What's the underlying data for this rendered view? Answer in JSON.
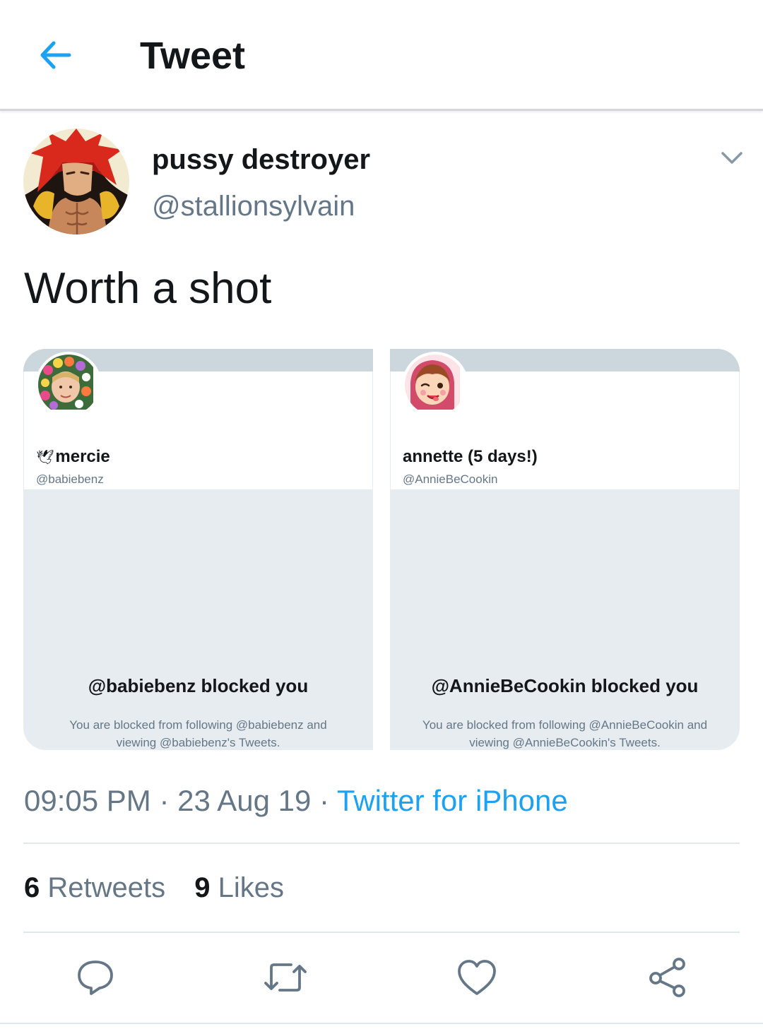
{
  "header": {
    "title": "Tweet",
    "back_icon": "arrow-left-icon"
  },
  "author": {
    "name": "pussy destroyer",
    "handle": "@stallionsylvain",
    "menu_icon": "chevron-down-icon"
  },
  "tweet": {
    "text": "Worth a shot"
  },
  "media": [
    {
      "emoji_prefix": "🕊",
      "name": "mercie",
      "handle": "@babiebenz",
      "blocked_title": "@babiebenz blocked you",
      "blocked_text": "You are blocked from following @babiebenz and viewing @babiebenz's Tweets."
    },
    {
      "name": "annette (5 days!)",
      "handle": "@AnnieBeCookin",
      "blocked_title": "@AnnieBeCookin blocked you",
      "blocked_text": "You are blocked from following @AnnieBeCookin and viewing @AnnieBeCookin's Tweets."
    }
  ],
  "meta": {
    "time": "09:05 PM",
    "separator": "·",
    "date": "23 Aug 19",
    "source": "Twitter for iPhone"
  },
  "stats": {
    "retweets_count": "6",
    "retweets_label": "Retweets",
    "likes_count": "9",
    "likes_label": "Likes"
  },
  "actions": [
    "reply-icon",
    "retweet-icon",
    "like-icon",
    "share-icon"
  ],
  "colors": {
    "accent": "#1da1f2",
    "text_primary": "#14171a",
    "text_secondary": "#657786",
    "icon_gray": "#657786"
  }
}
